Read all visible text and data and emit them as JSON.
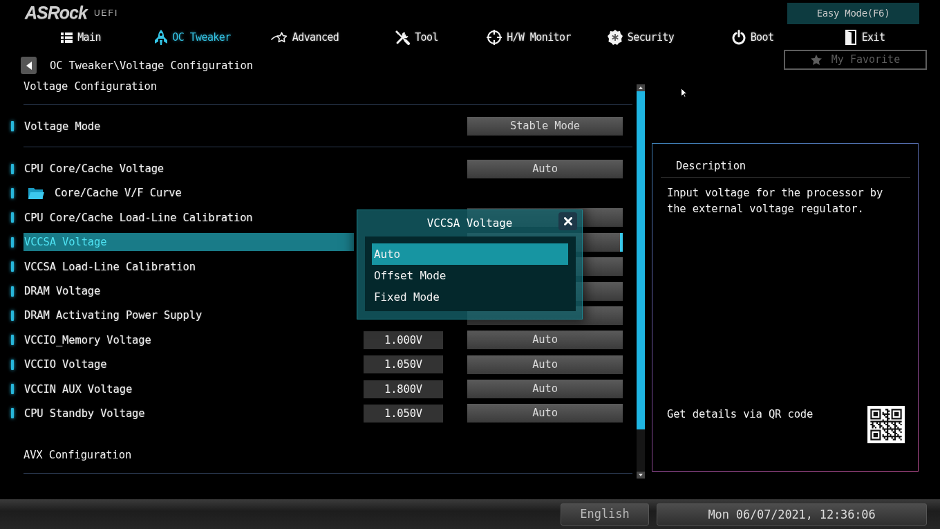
{
  "logo": {
    "brand": "ASRock",
    "product": "UEFI"
  },
  "easy_mode_button": "Easy Mode(F6)",
  "tabs": [
    {
      "label": "Main",
      "selected": false
    },
    {
      "label": "OC Tweaker",
      "selected": true
    },
    {
      "label": "Advanced",
      "selected": false
    },
    {
      "label": "Tool",
      "selected": false
    },
    {
      "label": "H/W Monitor",
      "selected": false
    },
    {
      "label": "Security",
      "selected": false
    },
    {
      "label": "Boot",
      "selected": false
    },
    {
      "label": "Exit",
      "selected": false
    }
  ],
  "breadcrumb": "OC Tweaker\\Voltage Configuration",
  "my_favorite_button": "My Favorite",
  "section_title": "Voltage Configuration",
  "settings": [
    {
      "kind": "setting",
      "label": "Voltage Mode",
      "selected": false,
      "value_2": "Stable Mode"
    },
    {
      "kind": "separator"
    },
    {
      "kind": "setting",
      "label": "CPU Core/Cache Voltage",
      "selected": false,
      "value_2": "Auto"
    },
    {
      "kind": "submenu",
      "label": "Core/Cache V/F Curve",
      "selected": false
    },
    {
      "kind": "setting",
      "label": "CPU Core/Cache Load-Line Calibration",
      "selected": false
    },
    {
      "kind": "setting",
      "label": "VCCSA Voltage",
      "selected": true
    },
    {
      "kind": "setting",
      "label": "VCCSA Load-Line Calibration",
      "selected": false
    },
    {
      "kind": "setting",
      "label": "DRAM Voltage",
      "selected": false
    },
    {
      "kind": "setting",
      "label": "DRAM Activating Power Supply",
      "selected": false
    },
    {
      "kind": "setting",
      "label": "VCCIO_Memory Voltage",
      "selected": false,
      "value_1": "1.000V",
      "value_2": "Auto"
    },
    {
      "kind": "setting",
      "label": "VCCIO Voltage",
      "selected": false,
      "value_1": "1.050V",
      "value_2": "Auto"
    },
    {
      "kind": "setting",
      "label": "VCCIN AUX Voltage",
      "selected": false,
      "value_1": "1.800V",
      "value_2": "Auto"
    },
    {
      "kind": "setting",
      "label": "CPU Standby Voltage",
      "selected": false,
      "value_1": "1.050V",
      "value_2": "Auto"
    },
    {
      "kind": "section",
      "label": "AVX Configuration",
      "selected": false
    }
  ],
  "dialog": {
    "title": "VCCSA Voltage",
    "options": [
      {
        "label": "Auto",
        "selected": true
      },
      {
        "label": "Offset Mode",
        "selected": false
      },
      {
        "label": "Fixed Mode",
        "selected": false
      }
    ]
  },
  "description": {
    "title": "Description",
    "text": "Input voltage for the processor by the external voltage regulator.",
    "qr_caption": "Get details via QR code"
  },
  "status_bar": {
    "language": "English",
    "date_time": "Mon 06/07/2021, 12:36:06"
  }
}
